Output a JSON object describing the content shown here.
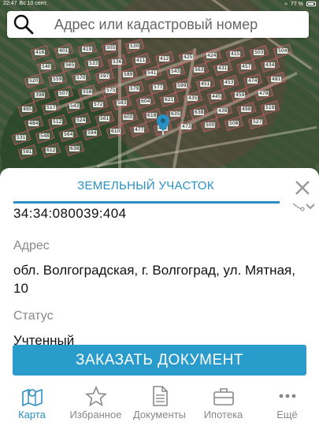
{
  "status_bar": {
    "time": "22:47",
    "date": "Вс 10 сент.",
    "battery": "77 %"
  },
  "search": {
    "placeholder": "Адрес или кадастровый номер"
  },
  "map": {
    "plot_numbers": [
      "416",
      "401",
      "419",
      "505",
      "530",
      "540",
      "565",
      "533",
      "536",
      "411",
      "412",
      "425",
      "424",
      "415",
      "503",
      "504",
      "520",
      "559",
      "570",
      "597",
      "589",
      "541",
      "543",
      "563",
      "431",
      "457",
      "434",
      "398",
      "507",
      "558",
      "575",
      "579",
      "577",
      "599",
      "451",
      "453",
      "474",
      "481",
      "495",
      "517",
      "543",
      "572",
      "583",
      "604",
      "621",
      "435",
      "445",
      "459",
      "479",
      "484",
      "512",
      "524",
      "561",
      "600",
      "618",
      "635",
      "638",
      "438",
      "498",
      "519",
      "531",
      "548",
      "564",
      "594",
      "610",
      "477",
      "462",
      "473",
      "500",
      "508",
      "527",
      "591",
      "612",
      "638"
    ]
  },
  "sheet": {
    "title": "ЗЕМЕЛЬНЫЙ УЧАСТОК",
    "cadastral_number": "34:34:080039:404",
    "address_label": "Адрес",
    "address_value": "обл. Волгоградская, г. Волгоград, ул. Мятная, 10",
    "status_label": "Статус",
    "status_value": "Учтенный",
    "order_button": "ЗАКАЗАТЬ ДОКУМЕНТ"
  },
  "tabs": [
    {
      "label": "Карта",
      "icon": "map-icon",
      "active": true
    },
    {
      "label": "Избранное",
      "icon": "star-icon",
      "active": false
    },
    {
      "label": "Документы",
      "icon": "document-icon",
      "active": false
    },
    {
      "label": "Ипотека",
      "icon": "briefcase-icon",
      "active": false
    },
    {
      "label": "Ещё",
      "icon": "more-icon",
      "active": false
    }
  ],
  "colors": {
    "accent": "#2a8fc1",
    "button": "#2a9ccb"
  }
}
